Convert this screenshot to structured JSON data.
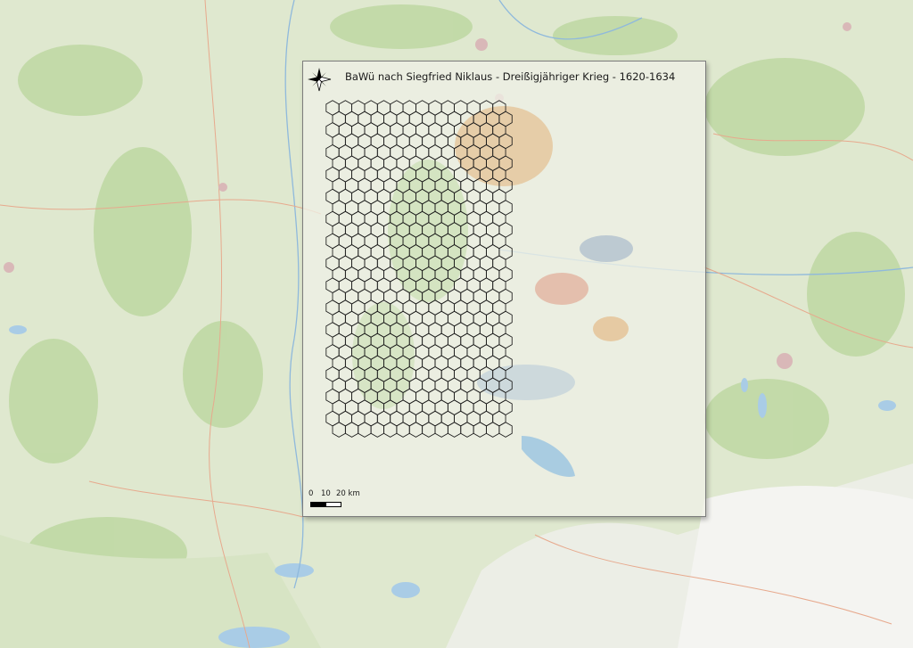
{
  "map": {
    "title": "BaWü nach Siegfried Niklaus - Dreißigjähriger Krieg - 1620-1634",
    "north_arrow_icon": "compass-rose-icon",
    "scalebar": {
      "labels": [
        "0",
        "10",
        "20 km"
      ]
    },
    "basemap_style": "topographic-map",
    "colors": {
      "land": "#dfe8cf",
      "forest": "#b7d39a",
      "water": "#a9cce6",
      "mountains": "#eeeeea",
      "hex_grid": "#1a1a1a",
      "highlight_orange": "#e2b27a",
      "highlight_red": "#e0a08a",
      "highlight_blue": "#9fb2c8"
    }
  }
}
